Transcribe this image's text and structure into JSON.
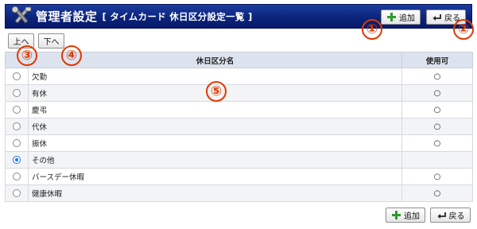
{
  "header": {
    "title": "管理者設定",
    "subtitle": "[ タイムカード  休日区分設定一覧 ]",
    "icon": "tools-icon"
  },
  "toolbar_top": {
    "add_label": "追加",
    "back_label": "戻る"
  },
  "toolbar_bottom": {
    "add_label": "追加",
    "back_label": "戻る"
  },
  "order": {
    "up_label": "上へ",
    "down_label": "下へ"
  },
  "markers": [
    "①",
    "②",
    "③",
    "④",
    "⑤"
  ],
  "table": {
    "headers": {
      "radio": "",
      "name": "休日区分名",
      "available": "使用可"
    },
    "rows": [
      {
        "name": "欠勤",
        "available": "○",
        "selected": false
      },
      {
        "name": "有休",
        "available": "○",
        "selected": false
      },
      {
        "name": "慶弔",
        "available": "○",
        "selected": false
      },
      {
        "name": "代休",
        "available": "○",
        "selected": false
      },
      {
        "name": "振休",
        "available": "○",
        "selected": false
      },
      {
        "name": "その他",
        "available": "",
        "selected": true
      },
      {
        "name": "バースデー休暇",
        "available": "○",
        "selected": false
      },
      {
        "name": "健康休暇",
        "available": "○",
        "selected": false
      }
    ]
  },
  "colors": {
    "header_bg": "#0a2379",
    "marker": "#e03a00",
    "add_icon": "#2e9b2e"
  }
}
